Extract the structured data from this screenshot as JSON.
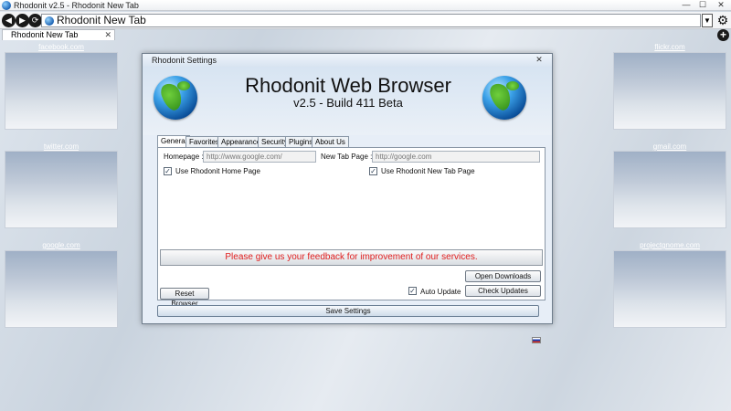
{
  "window": {
    "title": "Rhodonit v2.5 - Rhodonit New Tab",
    "minimize": "—",
    "maximize": "☐",
    "close": "✕"
  },
  "addressbar": {
    "back": "◀",
    "forward": "▶",
    "reload": "⟳",
    "url": "Rhodonit New Tab",
    "dropdown": "▼",
    "gear": "⚙"
  },
  "tabs": {
    "active_label": "Rhodonit New Tab",
    "close": "✕",
    "new_tab": "+"
  },
  "speed_dial": [
    {
      "label": "facebook.com"
    },
    {
      "label": "flickr.com"
    },
    {
      "label": "twitter.com"
    },
    {
      "label": "gmail.com"
    },
    {
      "label": "google.com"
    },
    {
      "label": "projectgnome.com"
    }
  ],
  "dialog": {
    "title": "Rhodonit Settings",
    "close": "✕",
    "heading": "Rhodonit Web Browser",
    "version": "v2.5 - Build 411 Beta",
    "tabs": [
      "General",
      "Favorites",
      "Appearance",
      "Security",
      "Plugins",
      "About Us"
    ],
    "homepage_label": "Homepage :",
    "homepage_value": "http://www.google.com/",
    "newtab_label": "New Tab Page :",
    "newtab_value": "http://google.com",
    "use_home_label": "Use Rhodonit Home Page",
    "use_newtab_label": "Use Rhodonit New Tab Page",
    "check_mark": "✓",
    "feedback": "Please give us your feedback for improvement of our services.",
    "open_downloads": "Open Downloads",
    "auto_update": "Auto Update",
    "check_updates": "Check Updates",
    "reset_browser": "Reset Browser",
    "save_settings": "Save Settings"
  },
  "colors": {
    "feedback_text": "#e01d1d",
    "accent": "#1b63b5"
  }
}
